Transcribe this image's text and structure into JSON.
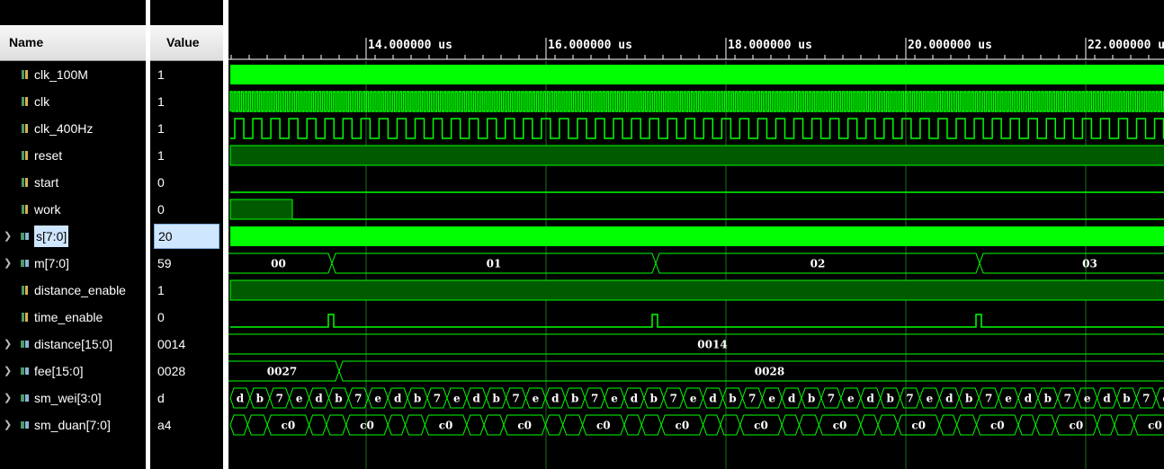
{
  "columns": {
    "name": "Name",
    "value": "Value"
  },
  "timeline": {
    "ticks": [
      {
        "t": 14,
        "label": "14.000000 us"
      },
      {
        "t": 16,
        "label": "16.000000 us"
      },
      {
        "t": 18,
        "label": "18.000000 us"
      },
      {
        "t": 20,
        "label": "20.000000 us"
      },
      {
        "t": 22,
        "label": "22.000000 us"
      }
    ]
  },
  "signals": [
    {
      "name": "clk_100M",
      "value": "1",
      "kind": "bit",
      "expandable": false
    },
    {
      "name": "clk",
      "value": "1",
      "kind": "bit",
      "expandable": false
    },
    {
      "name": "clk_400Hz",
      "value": "1",
      "kind": "bit",
      "expandable": false
    },
    {
      "name": "reset",
      "value": "1",
      "kind": "bit",
      "expandable": false
    },
    {
      "name": "start",
      "value": "0",
      "kind": "bit",
      "expandable": false
    },
    {
      "name": "work",
      "value": "0",
      "kind": "bit",
      "expandable": false
    },
    {
      "name": "s[7:0]",
      "value": "20",
      "kind": "bus",
      "expandable": true,
      "selected": true
    },
    {
      "name": "m[7:0]",
      "value": "59",
      "kind": "bus",
      "expandable": true
    },
    {
      "name": "distance_enable",
      "value": "1",
      "kind": "bit",
      "expandable": false
    },
    {
      "name": "time_enable",
      "value": "0",
      "kind": "bit",
      "expandable": false
    },
    {
      "name": "distance[15:0]",
      "value": "0014",
      "kind": "bus",
      "expandable": true
    },
    {
      "name": "fee[15:0]",
      "value": "0028",
      "kind": "bus",
      "expandable": true
    },
    {
      "name": "sm_wei[3:0]",
      "value": "d",
      "kind": "bus",
      "expandable": true
    },
    {
      "name": "sm_duan[7:0]",
      "value": "a4",
      "kind": "bus",
      "expandable": true
    }
  ],
  "bus_values": {
    "m": [
      "00",
      "01",
      "02",
      "03"
    ],
    "distance": [
      "0014"
    ],
    "fee": [
      "0027",
      "0028"
    ],
    "sm_wei_cycle": [
      "d",
      "b",
      "7",
      "e"
    ],
    "sm_duan": "c0"
  },
  "colors": {
    "wave": "#00ff00",
    "wave_fill": "#005a00",
    "grid": "#1c6e1c",
    "text": "#ffffff"
  }
}
